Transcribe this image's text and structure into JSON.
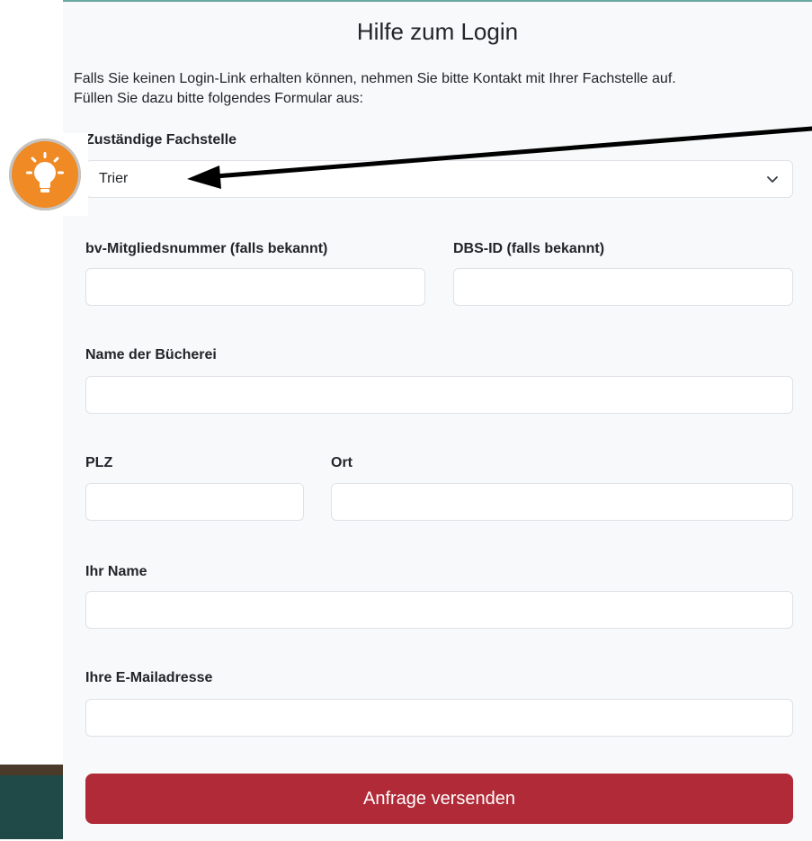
{
  "form": {
    "title": "Hilfe zum Login",
    "intro_line1": "Falls Sie keinen Login-Link erhalten können, nehmen Sie bitte Kontakt mit Ihrer Fachstelle auf.",
    "intro_line2": "Füllen Sie dazu bitte folgendes Formular aus:",
    "fachstelle_label": "Zuständige Fachstelle",
    "fachstelle_value": "Trier",
    "member_label": "bv-Mitgliedsnummer (falls bekannt)",
    "dbs_label": "DBS-ID (falls bekannt)",
    "library_label": "Name der Bücherei",
    "plz_label": "PLZ",
    "ort_label": "Ort",
    "name_label": "Ihr Name",
    "email_label": "Ihre E-Mailadresse",
    "submit_label": "Anfrage versenden"
  },
  "colors": {
    "submit_bg": "#b02a37",
    "bulb_bg": "#f08a24",
    "panel_bg": "#f8f9fa",
    "arrow": "#000000"
  },
  "icons": {
    "bulb": "lightbulb-icon",
    "chevron": "chevron-down-icon",
    "arrow": "pointer-arrow-annotation"
  }
}
